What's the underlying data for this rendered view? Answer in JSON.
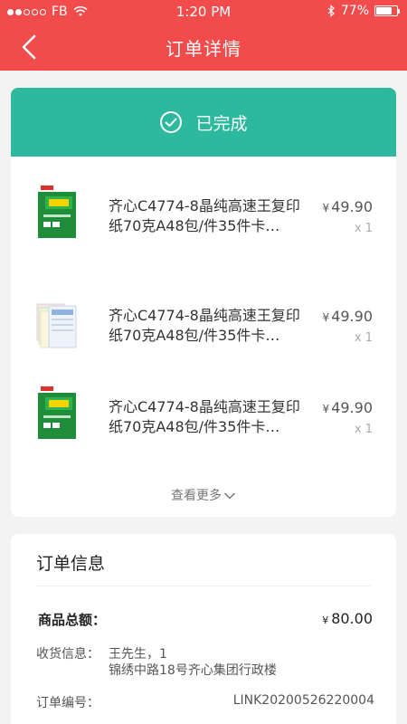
{
  "status_bar": {
    "carrier": "FB",
    "time": "1:20 PM",
    "battery": "77%",
    "battery_level": 0.77
  },
  "nav": {
    "title": "订单详情"
  },
  "order_status": {
    "label": "已完成"
  },
  "products": [
    {
      "name": "齐心C4774-8晶纯高速王复印纸70克A48包/件35件卡…",
      "price": "49.90",
      "currency": "¥",
      "qty": "x 1",
      "image": "paper-box-green"
    },
    {
      "name": "齐心C4774-8晶纯高速王复印纸70克A48包/件35件卡…",
      "price": "49.90",
      "currency": "¥",
      "qty": "x 1",
      "image": "paper-stack-color"
    },
    {
      "name": "齐心C4774-8晶纯高速王复印纸70克A48包/件35件卡…",
      "price": "49.90",
      "currency": "¥",
      "qty": "x 1",
      "image": "paper-box-green"
    }
  ],
  "view_more": "查看更多",
  "order_info": {
    "title": "订单信息",
    "total_label": "商品总额：",
    "total_currency": "¥",
    "total_value": "80.00",
    "address_label": "收货信息：",
    "address_name": "王先生，1",
    "address_line": "锦绣中路18号齐心集团行政楼",
    "order_no_label": "订单编号：",
    "order_no": "LINK20200526220004"
  },
  "colors": {
    "header": "#f24b4b",
    "status_green": "#2cb99d"
  }
}
